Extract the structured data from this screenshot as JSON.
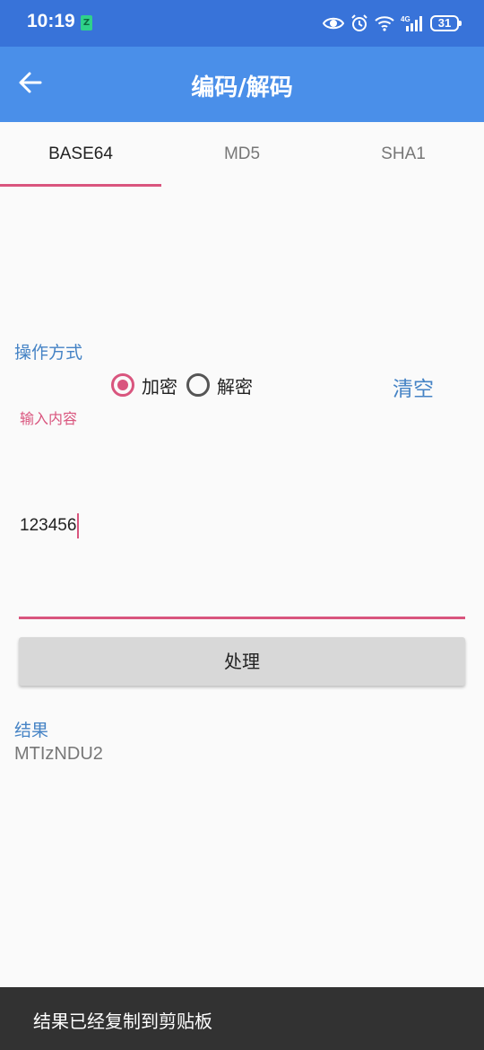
{
  "status_bar": {
    "time": "10:19",
    "app_icon": "Z",
    "icons": [
      "eye-icon",
      "alarm-icon",
      "wifi-icon",
      "signal-icon"
    ],
    "network": "4G",
    "battery": "31"
  },
  "app_bar": {
    "back_icon": "arrow-left-icon",
    "title": "编码/解码"
  },
  "tabs": [
    {
      "label": "BASE64",
      "active": true
    },
    {
      "label": "MD5",
      "active": false
    },
    {
      "label": "SHA1",
      "active": false
    }
  ],
  "operation": {
    "label": "操作方式",
    "options": [
      {
        "label": "加密",
        "selected": true
      },
      {
        "label": "解密",
        "selected": false
      }
    ],
    "clear_label": "清空"
  },
  "input": {
    "hint": "输入内容",
    "value": "123456"
  },
  "process_button": "处理",
  "result": {
    "label": "结果",
    "value": "MTIzNDU2"
  },
  "toast": "结果已经复制到剪贴板",
  "colors": {
    "status_bar": "#3873d9",
    "app_bar": "#4a8fe9",
    "accent": "#d9557e",
    "label_blue": "#4583c5"
  }
}
